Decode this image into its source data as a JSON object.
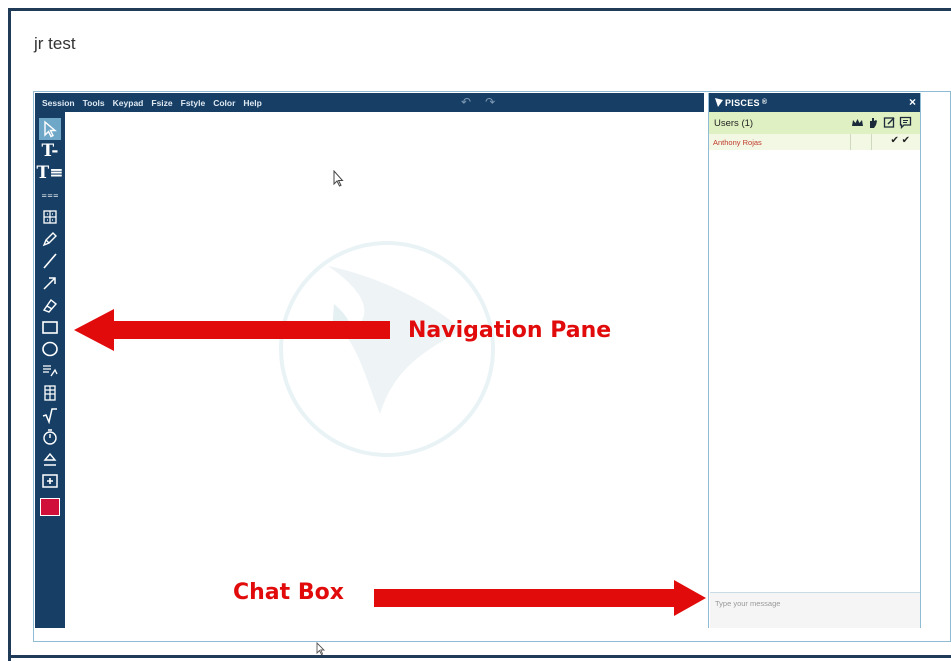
{
  "page": {
    "title": "jr test"
  },
  "menubar": {
    "items": [
      "Session",
      "Tools",
      "Keypad",
      "Fsize",
      "Fstyle",
      "Color",
      "Help"
    ]
  },
  "toolbar": {
    "tools": [
      {
        "name": "select-tool-icon",
        "active": true
      },
      {
        "name": "text-tool-icon"
      },
      {
        "name": "text-list-tool-icon"
      },
      {
        "name": "text-box-tool-icon"
      },
      {
        "name": "keypad-tool-icon"
      },
      {
        "name": "pen-tool-icon"
      },
      {
        "name": "line-tool-icon"
      },
      {
        "name": "arrow-tool-icon"
      },
      {
        "name": "eraser-tool-icon"
      },
      {
        "name": "rectangle-tool-icon"
      },
      {
        "name": "ellipse-tool-icon"
      },
      {
        "name": "graph-tool-icon"
      },
      {
        "name": "table-tool-icon"
      },
      {
        "name": "sqrt-tool-icon"
      },
      {
        "name": "timer-tool-icon"
      },
      {
        "name": "fill-tool-icon"
      },
      {
        "name": "add-page-tool-icon"
      },
      {
        "name": "color-swatch-icon"
      }
    ],
    "color_swatch": "#d0103a"
  },
  "sidebar": {
    "brand": "PISCES",
    "brand_mark": "®",
    "users_label": "Users (1)",
    "users": [
      {
        "name": "Anthony Rojas",
        "checks": "✔ ✔"
      }
    ],
    "chat_placeholder": "Type your message"
  },
  "annotations": {
    "nav_label": "Navigation Pane",
    "chat_label": "Chat Box",
    "color": "#e10b0b"
  },
  "colors": {
    "toolbar_bg": "#173f66",
    "users_bg": "#dff0c2",
    "frame": "#1f3b57"
  }
}
